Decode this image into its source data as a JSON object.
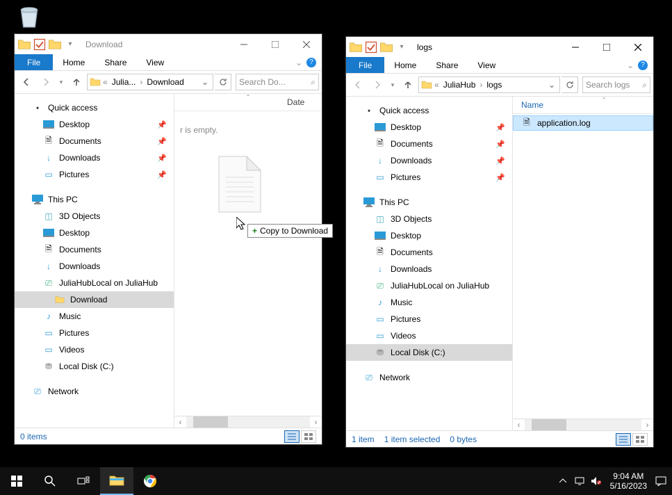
{
  "desktop": {
    "recycle_bin": "Recycle Bin"
  },
  "window_download": {
    "title": "Download",
    "ribbon": {
      "file": "File",
      "home": "Home",
      "share": "Share",
      "view": "View"
    },
    "breadcrumb": {
      "seg1": "Julia...",
      "seg2": "Download"
    },
    "search_placeholder": "Search Do...",
    "columns": {
      "date": "Date"
    },
    "empty_msg": "r is empty.",
    "sidebar": {
      "quick_access": "Quick access",
      "desktop": "Desktop",
      "documents": "Documents",
      "downloads": "Downloads",
      "pictures": "Pictures",
      "this_pc": "This PC",
      "objects3d": "3D Objects",
      "desktop2": "Desktop",
      "documents2": "Documents",
      "downloads2": "Downloads",
      "juliahub": "JuliaHubLocal on JuliaHub",
      "download_folder": "Download",
      "music": "Music",
      "pictures2": "Pictures",
      "videos": "Videos",
      "localdisk": "Local Disk (C:)",
      "network": "Network"
    },
    "status": {
      "items": "0 items"
    },
    "drag_tooltip": "Copy to Download"
  },
  "window_logs": {
    "title": "logs",
    "ribbon": {
      "file": "File",
      "home": "Home",
      "share": "Share",
      "view": "View"
    },
    "breadcrumb": {
      "seg1": "JuliaHub",
      "seg2": "logs"
    },
    "search_placeholder": "Search logs",
    "columns": {
      "name": "Name"
    },
    "files": {
      "app_log": "application.log"
    },
    "sidebar": {
      "quick_access": "Quick access",
      "desktop": "Desktop",
      "documents": "Documents",
      "downloads": "Downloads",
      "pictures": "Pictures",
      "this_pc": "This PC",
      "objects3d": "3D Objects",
      "desktop2": "Desktop",
      "documents2": "Documents",
      "downloads2": "Downloads",
      "juliahub": "JuliaHubLocal on JuliaHub",
      "music": "Music",
      "pictures2": "Pictures",
      "videos": "Videos",
      "localdisk": "Local Disk (C:)",
      "network": "Network"
    },
    "status": {
      "items": "1 item",
      "selected": "1 item selected",
      "size": "0 bytes"
    }
  },
  "taskbar": {
    "time": "9:04 AM",
    "date": "5/16/2023"
  }
}
